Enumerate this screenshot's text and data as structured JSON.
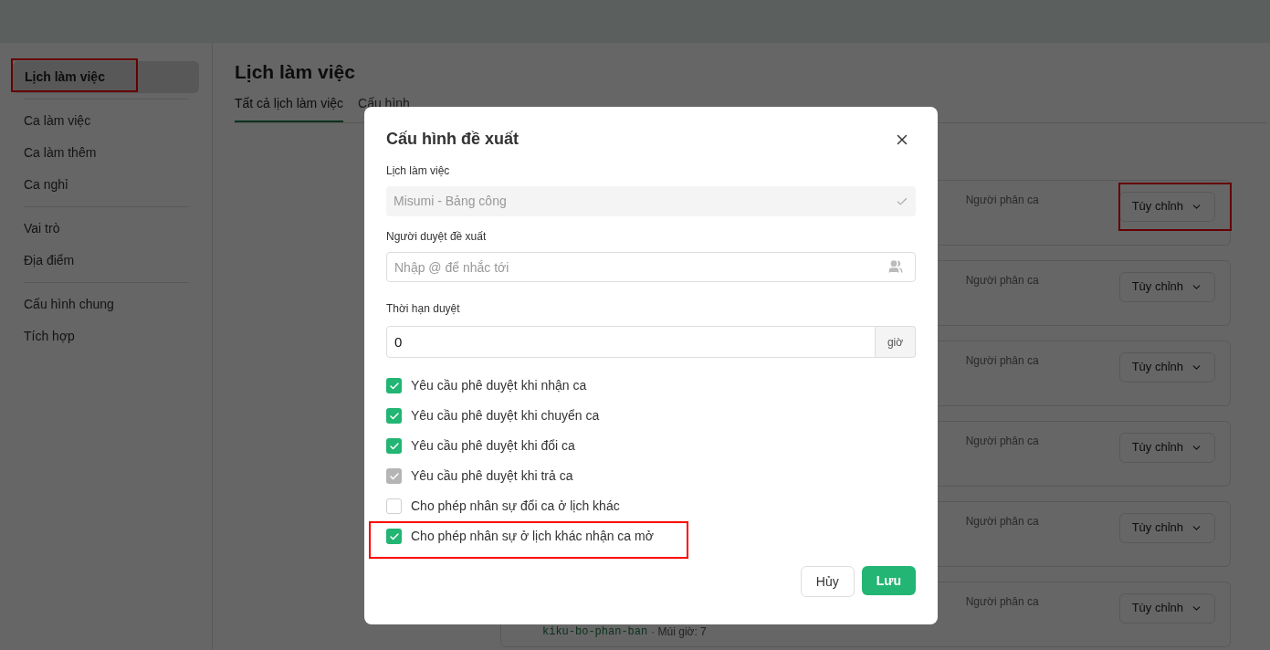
{
  "sidebar": {
    "groups": [
      {
        "items": [
          {
            "label": "Lịch làm việc",
            "selected": true
          }
        ]
      },
      {
        "items": [
          {
            "label": "Ca làm việc",
            "selected": false
          },
          {
            "label": "Ca làm thêm",
            "selected": false
          },
          {
            "label": "Ca nghỉ",
            "selected": false
          }
        ]
      },
      {
        "items": [
          {
            "label": "Vai trò",
            "selected": false
          },
          {
            "label": "Địa điểm",
            "selected": false
          }
        ]
      },
      {
        "items": [
          {
            "label": "Cấu hình chung",
            "selected": false
          },
          {
            "label": "Tích hợp",
            "selected": false
          }
        ]
      }
    ]
  },
  "page": {
    "title": "Lịch làm việc",
    "tabs": [
      {
        "label": "Tất cả lịch làm việc",
        "selected": true
      },
      {
        "label": "Cấu hình",
        "selected": false
      }
    ]
  },
  "cards": [
    {
      "assigner_label": "Người phân ca",
      "button": "Tùy chỉnh"
    },
    {
      "assigner_label": "Người phân ca",
      "button": "Tùy chỉnh"
    },
    {
      "assigner_label": "Người phân ca",
      "button": "Tùy chỉnh"
    },
    {
      "assigner_label": "Người phân ca",
      "button": "Tùy chỉnh"
    },
    {
      "assigner_label": "Người phân ca",
      "button": "Tùy chỉnh"
    },
    {
      "assigner_label": "Người phân ca",
      "button": "Tùy chỉnh",
      "slug": "kiku-bo-phan-ban",
      "timezone": "· Múi giờ: 7"
    }
  ],
  "dialog": {
    "title": "Cấu hình đề xuất",
    "schedule": {
      "label": "Lịch làm việc",
      "value": "Misumi - Bảng công",
      "disabled": true
    },
    "approver": {
      "label": "Người duyệt đề xuất",
      "placeholder": "Nhập @ để nhắc tới"
    },
    "deadline": {
      "label": "Thời hạn duyệt",
      "value": "0",
      "unit": "giờ"
    },
    "options": [
      {
        "label": "Yêu cầu phê duyệt khi nhận ca",
        "checked": true,
        "disabled": false
      },
      {
        "label": "Yêu cầu phê duyệt khi chuyển ca",
        "checked": true,
        "disabled": false
      },
      {
        "label": "Yêu cầu phê duyệt khi đổi ca",
        "checked": true,
        "disabled": false
      },
      {
        "label": "Yêu cầu phê duyệt khi trả ca",
        "checked": true,
        "disabled": true
      },
      {
        "label": "Cho phép nhân sự đổi ca ở lịch khác",
        "checked": false,
        "disabled": false
      },
      {
        "label": "Cho phép nhân sự ở lịch khác nhận ca mở",
        "checked": true,
        "disabled": false
      }
    ],
    "buttons": {
      "cancel": "Hủy",
      "save": "Lưu"
    }
  }
}
